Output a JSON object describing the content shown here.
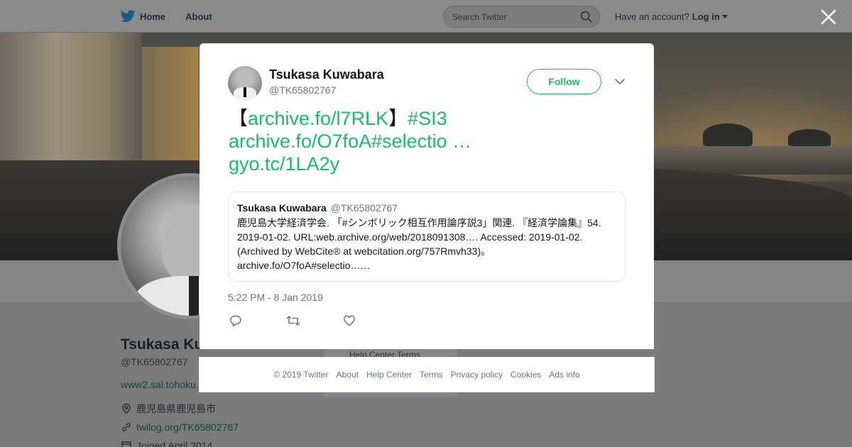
{
  "nav": {
    "home_label": "Home",
    "about_label": "About",
    "search_placeholder": "Search Twitter",
    "have_account": "Have an account?",
    "login_label": "Log in"
  },
  "profile": {
    "name": "Tsukasa Kuwabara",
    "handle": "@TK65802767",
    "url": "www2.sal.tohoku.",
    "location": "鹿児島県鹿児島市",
    "link": "twilog.org/TK65802767",
    "joined": "Joined April 2014",
    "ghost_links": "Help Center   Terms"
  },
  "tweet": {
    "author_name": "Tsukasa Kuwabara",
    "author_handle": "@TK65802767",
    "follow_label": "Follow",
    "text_part1_open": "【",
    "text_link1": "archive.fo/l7RLK",
    "text_part1_close": "】",
    "text_hashtag": "#SI3",
    "text_link2": "archive.fo/O7foA#selectio …",
    "text_link3": "gyo.tc/1LA2y",
    "quote": {
      "name": "Tsukasa Kuwabara",
      "handle": "@TK65802767",
      "line1": "鹿児島大学経済学会. 「#シンボリック相互作用論序説3」関連. 『経済学論集』54.",
      "line2": "2019-01-02. URL:web.archive.org/web/2018091308…. Accessed: 2019-01-02.",
      "line3": "(Archived by WebCite® at webcitation.org/757Rmvh33)。",
      "line4": "archive.fo/O7foA#selectio……"
    },
    "timestamp": "5:22 PM - 8 Jan 2019"
  },
  "footer": {
    "copyright": "© 2019 Twitter",
    "links": [
      "About",
      "Help Center",
      "Terms",
      "Privacy policy",
      "Cookies",
      "Ads info"
    ]
  },
  "colors": {
    "accent": "#17bf63",
    "text": "#14171a",
    "secondary": "#657786",
    "twitter_blue": "#1da1f2"
  },
  "icons": [
    "twitter-bird-icon",
    "search-icon",
    "close-icon",
    "chevron-down-icon",
    "reply-icon",
    "retweet-icon",
    "like-icon",
    "location-icon",
    "link-icon",
    "calendar-icon"
  ]
}
